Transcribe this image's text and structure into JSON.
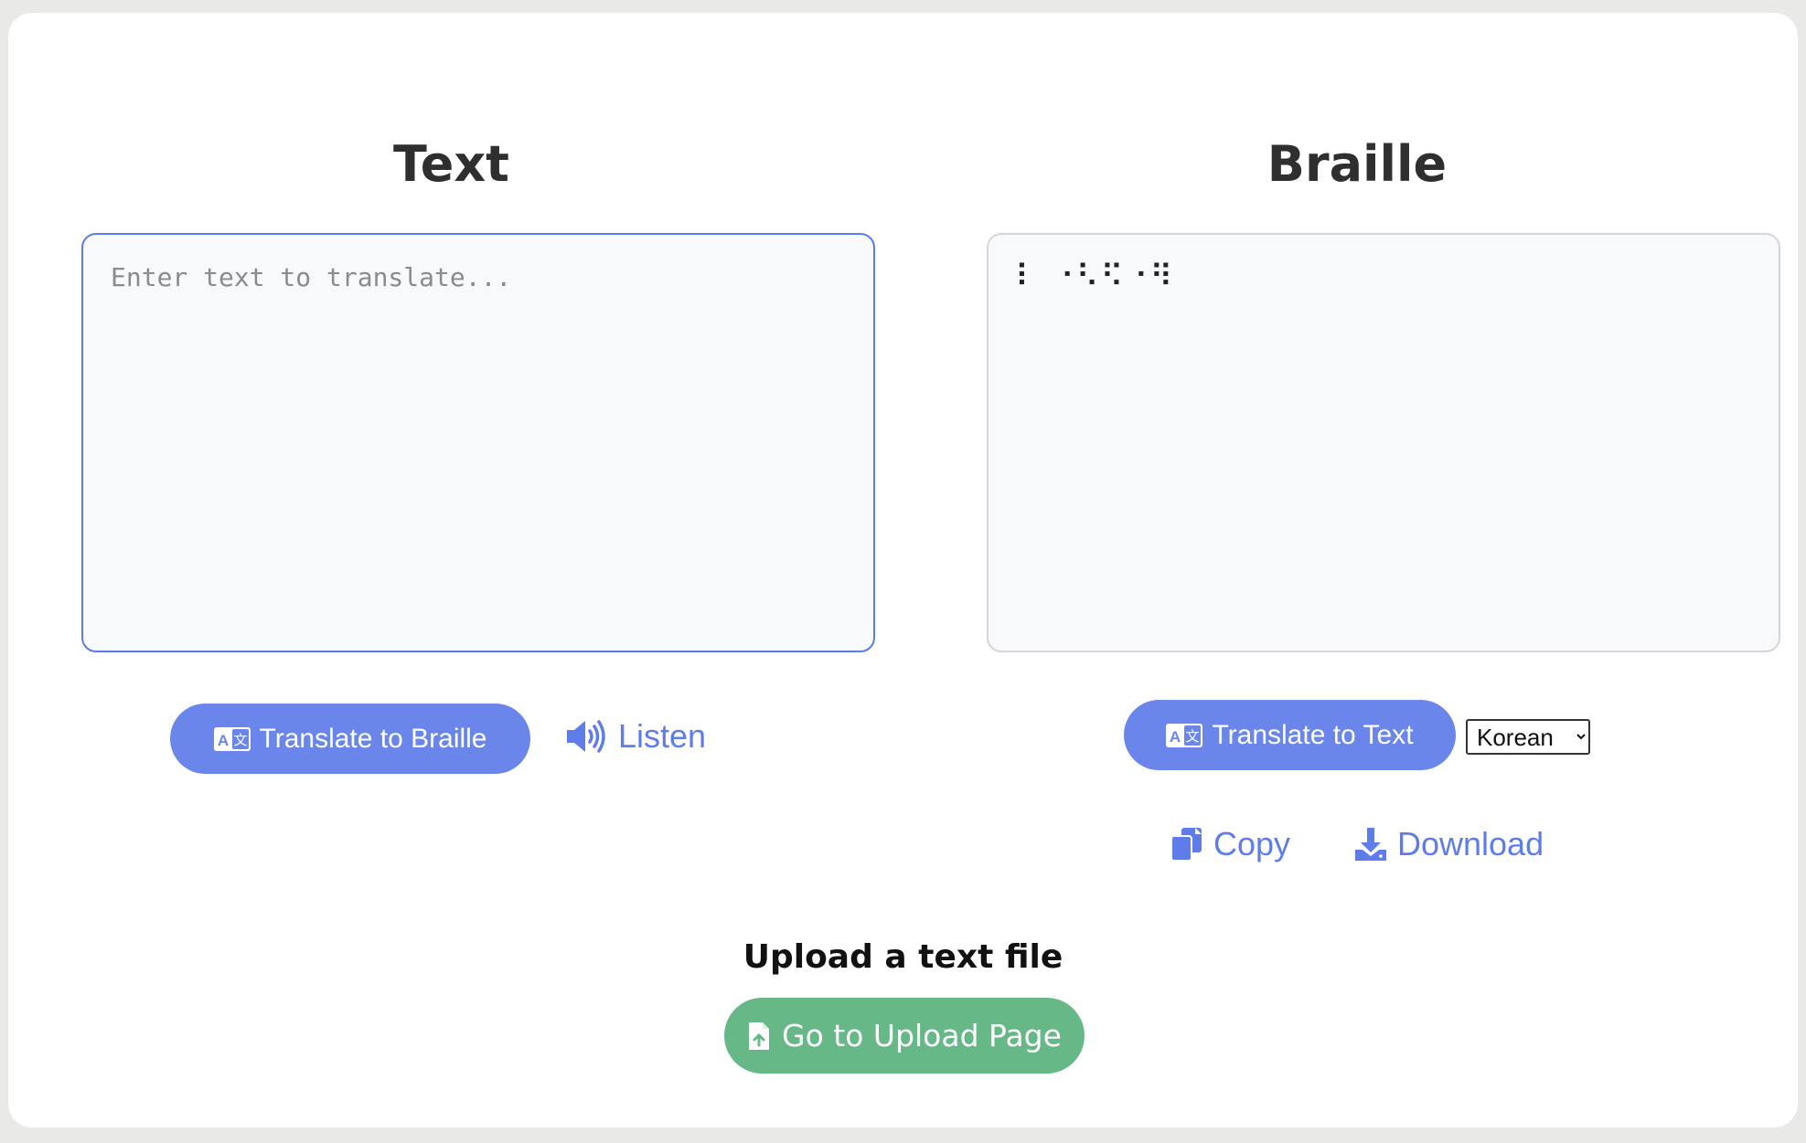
{
  "text_panel": {
    "title": "Text",
    "input_placeholder": "Enter text to translate...",
    "input_value": ""
  },
  "braille_panel": {
    "title": "Braille",
    "output_value": "⠇ ⠐⠣⠫⠐⠻"
  },
  "actions": {
    "translate_to_braille_label": "Translate to Braille",
    "listen_label": "Listen",
    "translate_to_text_label": "Translate to Text",
    "copy_label": "Copy",
    "download_label": "Download"
  },
  "language_select": {
    "selected": "Korean"
  },
  "upload": {
    "heading": "Upload a text file",
    "button_label": "Go to Upload Page"
  },
  "colors": {
    "primary": "#6a86ea",
    "link": "#5f7de8",
    "upload": "#66b887",
    "input_border_active": "#5a7ce9"
  },
  "icons": {
    "translate": "translate-icon",
    "listen": "speaker-icon",
    "copy": "copy-icon",
    "download": "download-icon",
    "upload_file": "file-upload-icon"
  }
}
